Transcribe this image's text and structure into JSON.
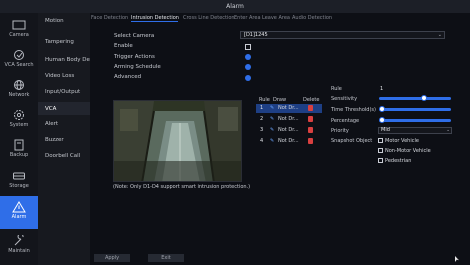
{
  "window": {
    "title": "Alarm"
  },
  "nav": {
    "items": [
      {
        "id": "camera",
        "label": "Camera",
        "icon": "camera-icon"
      },
      {
        "id": "vca-search",
        "label": "VCA Search",
        "icon": "vca-search-icon"
      },
      {
        "id": "network",
        "label": "Network",
        "icon": "globe-icon"
      },
      {
        "id": "system",
        "label": "System",
        "icon": "gear-icon"
      },
      {
        "id": "backup",
        "label": "Backup",
        "icon": "backup-icon"
      },
      {
        "id": "storage",
        "label": "Storage",
        "icon": "storage-icon"
      },
      {
        "id": "alarm",
        "label": "Alarm",
        "icon": "alarm-icon",
        "active": true
      },
      {
        "id": "maintain",
        "label": "Maintain",
        "icon": "wrench-icon"
      }
    ]
  },
  "submenu": {
    "items": [
      "Motion",
      "Tampering",
      "Human Body Det...",
      "Video Loss",
      "Input/Output",
      "VCA",
      "Alert",
      "Buzzer",
      "Doorbell Call"
    ],
    "active": "VCA"
  },
  "tabs": {
    "items": [
      "Face Detection",
      "Intrusion Detection",
      "Cross Line Detection",
      "Enter Area",
      "Leave Area",
      "Audio Detection"
    ],
    "active": "Intrusion Detection"
  },
  "form": {
    "select_camera_label": "Select Camera",
    "select_camera_value": "[D1]1245",
    "enable_label": "Enable",
    "trigger_actions_label": "Trigger Actions",
    "arming_schedule_label": "Arming Schedule",
    "advanced_label": "Advanced"
  },
  "rules_table": {
    "headers": {
      "rule": "Rule",
      "draw": "Draw",
      "delete": "Delete"
    },
    "rows": [
      {
        "num": "1",
        "draw": "Not Dr..."
      },
      {
        "num": "2",
        "draw": "Not Dr..."
      },
      {
        "num": "3",
        "draw": "Not Dr..."
      },
      {
        "num": "4",
        "draw": "Not Dr..."
      }
    ]
  },
  "params": {
    "rule_label": "Rule",
    "rule_value": "1",
    "sensitivity_label": "Sensitivity",
    "sensitivity_level": 0.62,
    "time_threshold_label": "Time Threshold(s)",
    "time_threshold_level": 0.0,
    "percentage_label": "Percentage",
    "percentage_level": 0.0,
    "priority_label": "Priority",
    "priority_value": "Mid",
    "snapshot_label": "Snapshot Object",
    "snapshot_options": [
      "Motor Vehicle",
      "Non-Motor Vehicle",
      "Pedestrian"
    ]
  },
  "note": "(Note: Only D1-D4 support smart intrusion protection.)",
  "buttons": {
    "apply": "Apply",
    "exit": "Exit"
  },
  "colors": {
    "accent": "#2f6ee8",
    "delete": "#d94040",
    "background": "#0d0f15"
  }
}
